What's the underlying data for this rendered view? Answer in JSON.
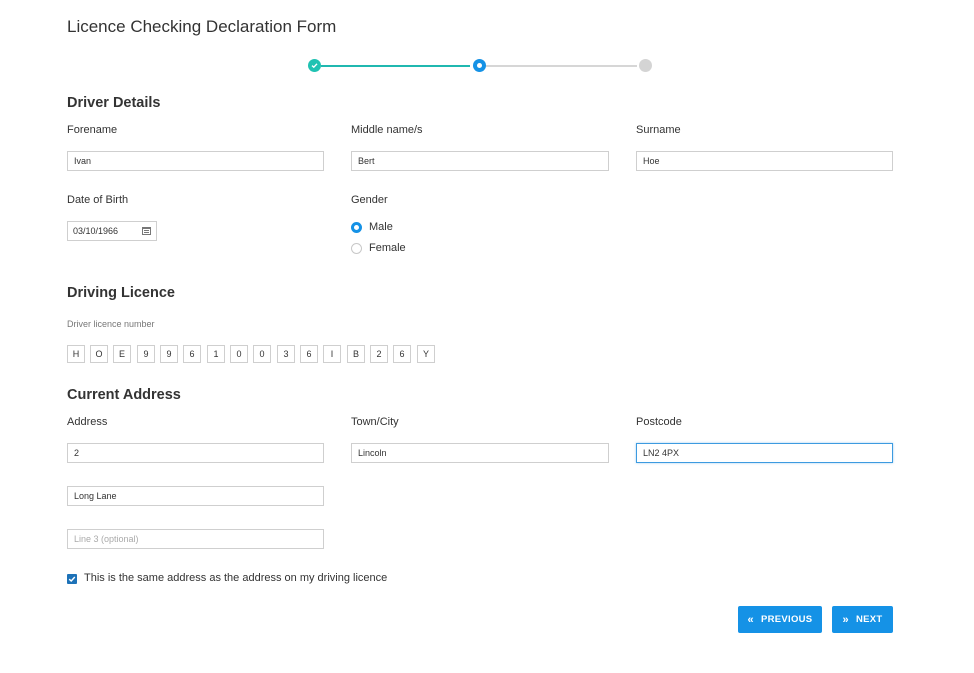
{
  "page": {
    "title": "Licence Checking Declaration Form"
  },
  "stepper": {
    "steps": [
      "complete",
      "current",
      "pending"
    ]
  },
  "driver_details": {
    "heading": "Driver Details",
    "forename": {
      "label": "Forename",
      "value": "Ivan"
    },
    "middle_names": {
      "label": "Middle name/s",
      "value": "Bert"
    },
    "surname": {
      "label": "Surname",
      "value": "Hoe"
    },
    "dob": {
      "label": "Date of Birth",
      "value": "03/10/1966"
    },
    "gender": {
      "label": "Gender",
      "options": [
        {
          "label": "Male",
          "selected": true
        },
        {
          "label": "Female",
          "selected": false
        }
      ]
    }
  },
  "driving_licence": {
    "heading": "Driving Licence",
    "number_label": "Driver licence number",
    "characters": [
      "H",
      "O",
      "E",
      "9",
      "9",
      "6",
      "1",
      "0",
      "0",
      "3",
      "6",
      "I",
      "B",
      "2",
      "6",
      "Y"
    ]
  },
  "current_address": {
    "heading": "Current Address",
    "address": {
      "label": "Address",
      "line1": "2",
      "line2": "Long Lane",
      "line3_placeholder": "Line 3 (optional)"
    },
    "town": {
      "label": "Town/City",
      "value": "Lincoln"
    },
    "postcode": {
      "label": "Postcode",
      "value": "LN2 4PX"
    },
    "same_address": {
      "label": "This is the same address as the address on my driving licence",
      "checked": true
    }
  },
  "actions": {
    "previous_label": "PREVIOUS",
    "next_label": "NEXT"
  },
  "colors": {
    "accent": "#1592e6",
    "complete": "#20c2b2",
    "pending": "#d4d4d4"
  }
}
